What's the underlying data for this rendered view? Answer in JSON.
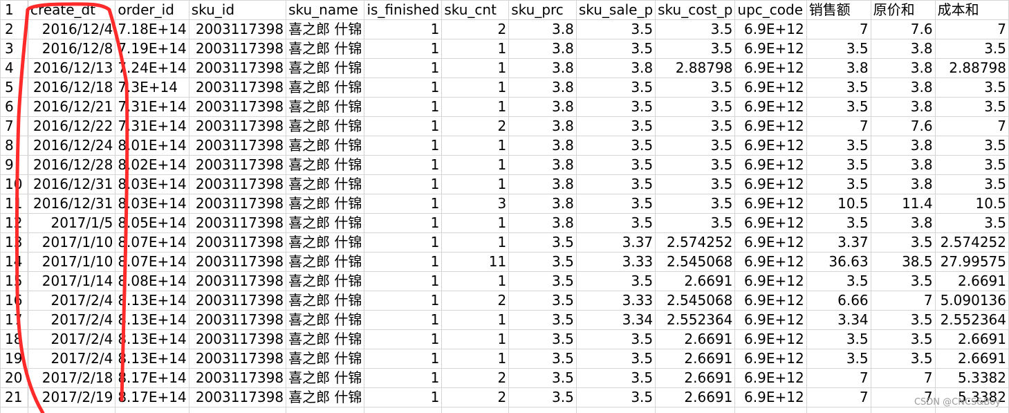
{
  "sheet": {
    "header_row_number": "1",
    "headers": [
      "create_dt",
      "order_id",
      "sku_id",
      "sku_name",
      "is_finished",
      "sku_cnt",
      "sku_prc",
      "sku_sale_p",
      "sku_cost_p",
      "upc_code",
      "销售额",
      "原价和",
      "成本和"
    ],
    "rows": [
      {
        "n": "2",
        "cells": [
          "2016/12/4",
          "7.18E+14",
          "2003117398",
          "喜之郎 什锦",
          "1",
          "2",
          "3.8",
          "3.5",
          "3.5",
          "6.9E+12",
          "7",
          "7.6",
          "7"
        ]
      },
      {
        "n": "3",
        "cells": [
          "2016/12/8",
          "7.19E+14",
          "2003117398",
          "喜之郎 什锦",
          "1",
          "1",
          "3.8",
          "3.5",
          "3.5",
          "6.9E+12",
          "3.5",
          "3.8",
          "3.5"
        ]
      },
      {
        "n": "4",
        "cells": [
          "2016/12/13",
          "7.24E+14",
          "2003117398",
          "喜之郎 什锦",
          "1",
          "1",
          "3.8",
          "3.8",
          "2.88798",
          "6.9E+12",
          "3.8",
          "3.8",
          "2.88798"
        ]
      },
      {
        "n": "5",
        "cells": [
          "2016/12/18",
          "7.3E+14",
          "2003117398",
          "喜之郎 什锦",
          "1",
          "1",
          "3.8",
          "3.5",
          "3.5",
          "6.9E+12",
          "3.5",
          "3.8",
          "3.5"
        ]
      },
      {
        "n": "6",
        "cells": [
          "2016/12/21",
          "7.31E+14",
          "2003117398",
          "喜之郎 什锦",
          "1",
          "1",
          "3.8",
          "3.5",
          "3.5",
          "6.9E+12",
          "3.5",
          "3.8",
          "3.5"
        ]
      },
      {
        "n": "7",
        "cells": [
          "2016/12/22",
          "7.31E+14",
          "2003117398",
          "喜之郎 什锦",
          "1",
          "2",
          "3.8",
          "3.5",
          "3.5",
          "6.9E+12",
          "7",
          "7.6",
          "7"
        ]
      },
      {
        "n": "8",
        "cells": [
          "2016/12/24",
          "8.01E+14",
          "2003117398",
          "喜之郎 什锦",
          "1",
          "1",
          "3.8",
          "3.5",
          "3.5",
          "6.9E+12",
          "3.5",
          "3.8",
          "3.5"
        ]
      },
      {
        "n": "9",
        "cells": [
          "2016/12/28",
          "8.02E+14",
          "2003117398",
          "喜之郎 什锦",
          "1",
          "1",
          "3.8",
          "3.5",
          "3.5",
          "6.9E+12",
          "3.5",
          "3.8",
          "3.5"
        ]
      },
      {
        "n": "10",
        "cells": [
          "2016/12/31",
          "8.03E+14",
          "2003117398",
          "喜之郎 什锦",
          "1",
          "1",
          "3.8",
          "3.5",
          "3.5",
          "6.9E+12",
          "3.5",
          "3.8",
          "3.5"
        ]
      },
      {
        "n": "11",
        "cells": [
          "2016/12/31",
          "8.03E+14",
          "2003117398",
          "喜之郎 什锦",
          "1",
          "3",
          "3.8",
          "3.5",
          "3.5",
          "6.9E+12",
          "10.5",
          "11.4",
          "10.5"
        ]
      },
      {
        "n": "12",
        "cells": [
          "2017/1/5",
          "8.05E+14",
          "2003117398",
          "喜之郎 什锦",
          "1",
          "1",
          "3.8",
          "3.5",
          "3.5",
          "6.9E+12",
          "3.5",
          "3.8",
          "3.5"
        ]
      },
      {
        "n": "13",
        "cells": [
          "2017/1/10",
          "8.07E+14",
          "2003117398",
          "喜之郎 什锦",
          "1",
          "1",
          "3.5",
          "3.37",
          "2.574252",
          "6.9E+12",
          "3.37",
          "3.5",
          "2.574252"
        ]
      },
      {
        "n": "14",
        "cells": [
          "2017/1/10",
          "8.07E+14",
          "2003117398",
          "喜之郎 什锦",
          "1",
          "11",
          "3.5",
          "3.33",
          "2.545068",
          "6.9E+12",
          "36.63",
          "38.5",
          "27.99575"
        ]
      },
      {
        "n": "15",
        "cells": [
          "2017/1/14",
          "8.08E+14",
          "2003117398",
          "喜之郎 什锦",
          "1",
          "1",
          "3.5",
          "3.5",
          "2.6691",
          "6.9E+12",
          "3.5",
          "3.5",
          "2.6691"
        ]
      },
      {
        "n": "16",
        "cells": [
          "2017/2/4",
          "8.13E+14",
          "2003117398",
          "喜之郎 什锦",
          "1",
          "2",
          "3.5",
          "3.33",
          "2.545068",
          "6.9E+12",
          "6.66",
          "7",
          "5.090136"
        ]
      },
      {
        "n": "17",
        "cells": [
          "2017/2/4",
          "8.13E+14",
          "2003117398",
          "喜之郎 什锦",
          "1",
          "1",
          "3.5",
          "3.34",
          "2.552364",
          "6.9E+12",
          "3.34",
          "3.5",
          "2.552364"
        ]
      },
      {
        "n": "18",
        "cells": [
          "2017/2/4",
          "8.13E+14",
          "2003117398",
          "喜之郎 什锦",
          "1",
          "1",
          "3.5",
          "3.5",
          "2.6691",
          "6.9E+12",
          "3.5",
          "3.5",
          "2.6691"
        ]
      },
      {
        "n": "19",
        "cells": [
          "2017/2/4",
          "8.13E+14",
          "2003117398",
          "喜之郎 什锦",
          "1",
          "1",
          "3.5",
          "3.5",
          "2.6691",
          "6.9E+12",
          "3.5",
          "3.5",
          "2.6691"
        ]
      },
      {
        "n": "20",
        "cells": [
          "2017/2/18",
          "8.17E+14",
          "2003117398",
          "喜之郎 什锦",
          "1",
          "2",
          "3.5",
          "3.5",
          "2.6691",
          "6.9E+12",
          "7",
          "7",
          "5.3382"
        ]
      },
      {
        "n": "21",
        "cells": [
          "2017/2/19",
          "8.17E+14",
          "2003117398",
          "喜之郎 什锦",
          "1",
          "2",
          "3.5",
          "3.5",
          "2.6691",
          "6.9E+12",
          "7",
          "7",
          "5.3382"
        ]
      }
    ]
  },
  "annotation": {
    "shape": "hand-drawn red outline around create_dt column",
    "color": "#ff2a2a"
  },
  "watermark": "CSDN @CNCS&Boy"
}
